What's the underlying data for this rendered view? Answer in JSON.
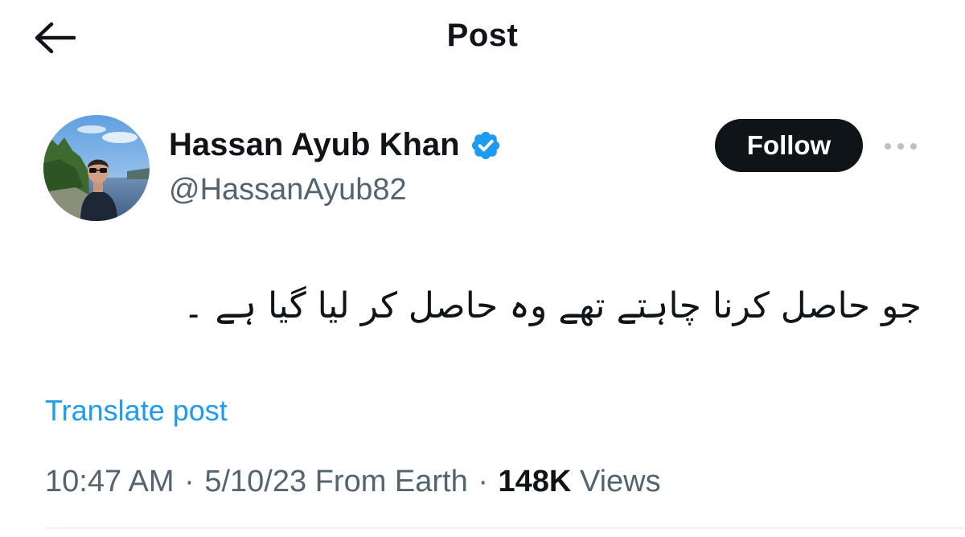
{
  "header": {
    "title": "Post",
    "back_icon": "arrow-left-icon"
  },
  "author": {
    "name": "Hassan Ayub Khan",
    "handle": "@HassanAyub82",
    "verified_icon": "verified-badge-icon",
    "verified_color": "#1d9bf0"
  },
  "actions": {
    "follow_label": "Follow",
    "more_icon": "more-horizontal-icon"
  },
  "post": {
    "text": "جو حاصل کرنا چاہتے تھے وہ حاصل کر لیا گیا ہے ۔",
    "translate_label": "Translate post"
  },
  "meta": {
    "time": "10:47 AM",
    "dot1": "·",
    "date": "5/10/23",
    "source": "From Earth",
    "dot2": "·",
    "views_count": "148K",
    "views_label": "Views"
  },
  "colors": {
    "text": "#0f1419",
    "secondary": "#536471",
    "accent": "#1d9bf0",
    "follow_bg": "#0f1419"
  }
}
